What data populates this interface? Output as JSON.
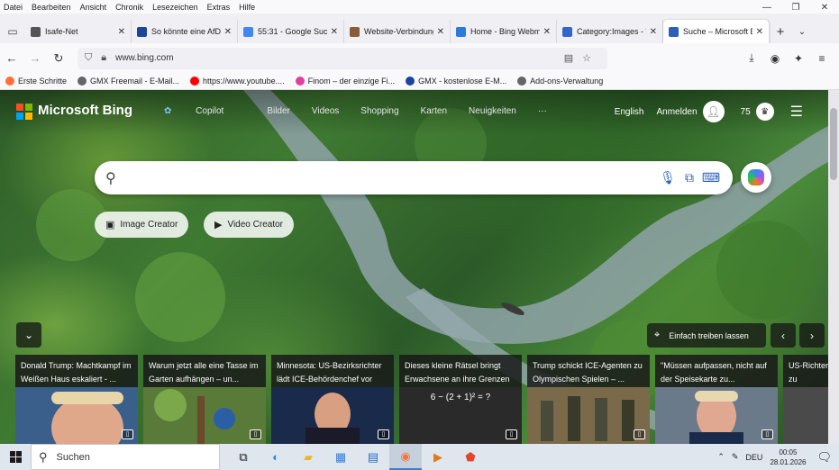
{
  "menubar": [
    "Datei",
    "Bearbeiten",
    "Ansicht",
    "Chronik",
    "Lesezeichen",
    "Extras",
    "Hilfe"
  ],
  "tabs": [
    {
      "title": "Isafe-Net",
      "fav": "pin",
      "color": "#555555"
    },
    {
      "title": "So könnte eine AfD-",
      "fav": "GMX",
      "color": "#1c449b"
    },
    {
      "title": "55:31 - Google Such",
      "fav": "G",
      "color": "#4285f4"
    },
    {
      "title": "Website-Verbindung",
      "fav": "img",
      "color": "#8a5a3a"
    },
    {
      "title": "Home - Bing Webma",
      "fav": "b",
      "color": "#2b7bdc"
    },
    {
      "title": "Category:Images - W",
      "fav": "w",
      "color": "#3366cc"
    },
    {
      "title": "Suche – Microsoft Bi",
      "fav": "search",
      "color": "#2b5fb8",
      "active": true
    }
  ],
  "url": "www.bing.com",
  "bookmarks": [
    {
      "label": "Erste Schritte",
      "color": "#ff7139"
    },
    {
      "label": "GMX Freemail - E-Mail...",
      "color": "#666666"
    },
    {
      "label": "https://www.youtube....",
      "color": "#ff0000"
    },
    {
      "label": "Finom – der einzige Fi...",
      "color": "#e040a0"
    },
    {
      "label": "GMX - kostenlose E-M...",
      "color": "#1c449b"
    },
    {
      "label": "Add-ons-Verwaltung",
      "color": "#666666"
    }
  ],
  "bing": {
    "brand": "Microsoft Bing",
    "nav": [
      "Copilot",
      "Bilder",
      "Videos",
      "Shopping",
      "Karten",
      "Neuigkeiten",
      "···"
    ],
    "language": "English",
    "signin": "Anmelden",
    "points": "75",
    "image_creator": "Image Creator",
    "video_creator": "Video Creator",
    "drift_label": "Einfach treiben lassen"
  },
  "news": [
    {
      "headline": "Donald Trump: Machtkampf im Weißen Haus eskaliert - ...",
      "thumb": "face1"
    },
    {
      "headline": "Warum jetzt alle eine Tasse im Garten aufhängen – un...",
      "thumb": "garden"
    },
    {
      "headline": "Minnesota: US-Bezirksrichter lädt ICE-Behördenchef vor",
      "thumb": "face2"
    },
    {
      "headline": "Dieses kleine Rätsel bringt Erwachsene an ihre Grenzen",
      "thumb": "math",
      "formula": "6 − (2 + 1)² = ?"
    },
    {
      "headline": "Trump schickt ICE-Agenten zu Olympischen Spielen – ...",
      "thumb": "agents"
    },
    {
      "headline": "\"Müssen aufpassen, nicht auf der Speisekarte zu...",
      "thumb": "face3"
    },
    {
      "headline": "US-Richter zu verweig...",
      "thumb": "misc"
    }
  ],
  "taskbar": {
    "search_label": "Suchen",
    "lang": "DEU",
    "time": "00:05",
    "date": "28.01.2026"
  }
}
